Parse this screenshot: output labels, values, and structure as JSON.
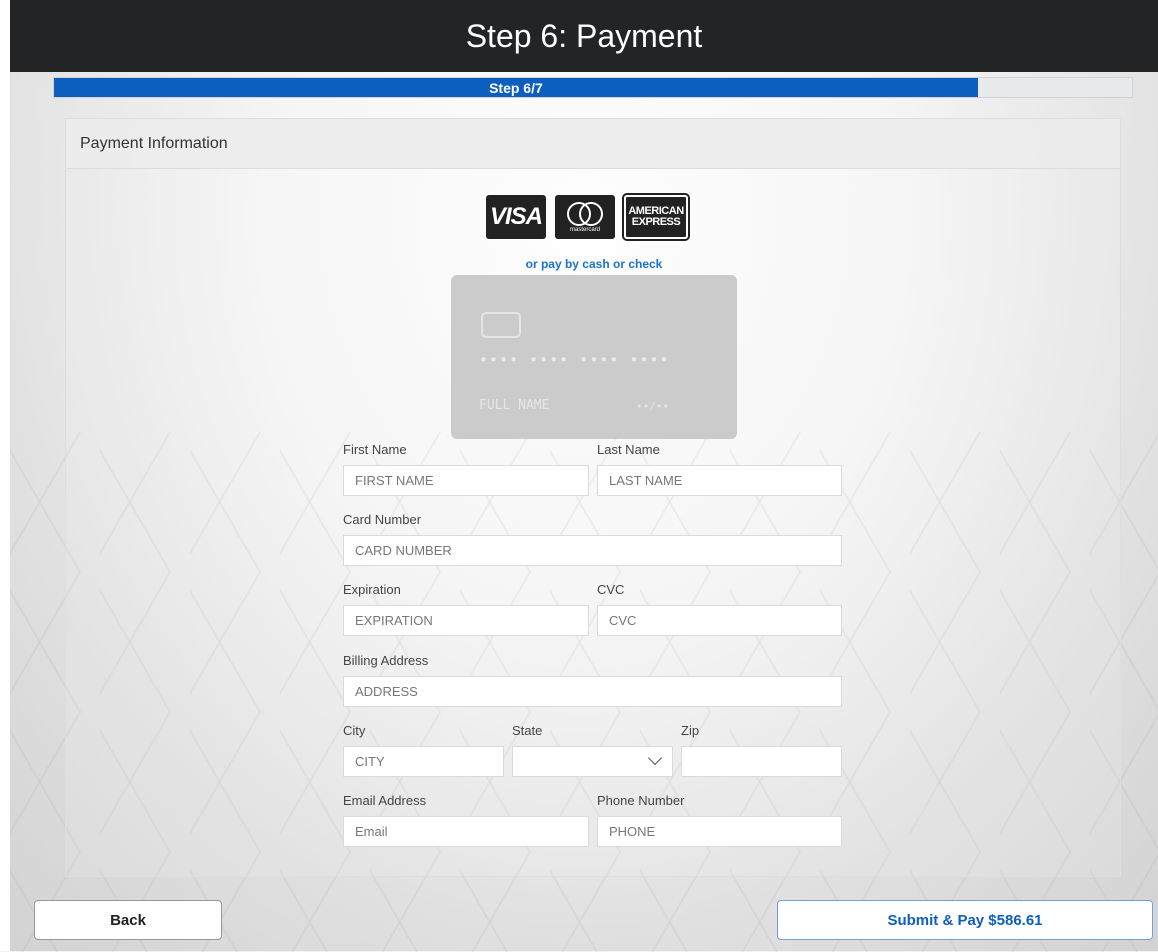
{
  "header": {
    "title": "Step 6: Payment"
  },
  "progress": {
    "label": "Step 6/7",
    "value": 0.857
  },
  "panel": {
    "title": "Payment Information"
  },
  "card_logos": [
    {
      "name": "visa",
      "text": "VISA"
    },
    {
      "name": "mastercard",
      "text": "mastercard"
    },
    {
      "name": "amex",
      "text_line1": "AMERICAN",
      "text_line2": "EXPRESS"
    }
  ],
  "pay_alt_link": "or pay by cash or check",
  "card_preview": {
    "number": "•••• •••• •••• ••••",
    "name": "FULL NAME",
    "expiry": "••/••"
  },
  "form": {
    "first_name": {
      "label": "First Name",
      "placeholder": "FIRST NAME"
    },
    "last_name": {
      "label": "Last Name",
      "placeholder": "LAST NAME"
    },
    "card_number": {
      "label": "Card Number",
      "placeholder": "CARD NUMBER"
    },
    "expiration": {
      "label": "Expiration",
      "placeholder": "EXPIRATION"
    },
    "cvc": {
      "label": "CVC",
      "placeholder": "CVC"
    },
    "billing_address": {
      "label": "Billing Address",
      "placeholder": "ADDRESS"
    },
    "city": {
      "label": "City",
      "placeholder": "CITY"
    },
    "state": {
      "label": "State",
      "value": ""
    },
    "zip": {
      "label": "Zip",
      "placeholder": ""
    },
    "email": {
      "label": "Email Address",
      "placeholder": "Email"
    },
    "phone": {
      "label": "Phone Number",
      "placeholder": "PHONE"
    }
  },
  "buttons": {
    "back": "Back",
    "submit": "Submit & Pay $586.61"
  },
  "colors": {
    "header_bg": "#222426",
    "accent": "#0d5fbf",
    "link": "#1a73c9"
  }
}
